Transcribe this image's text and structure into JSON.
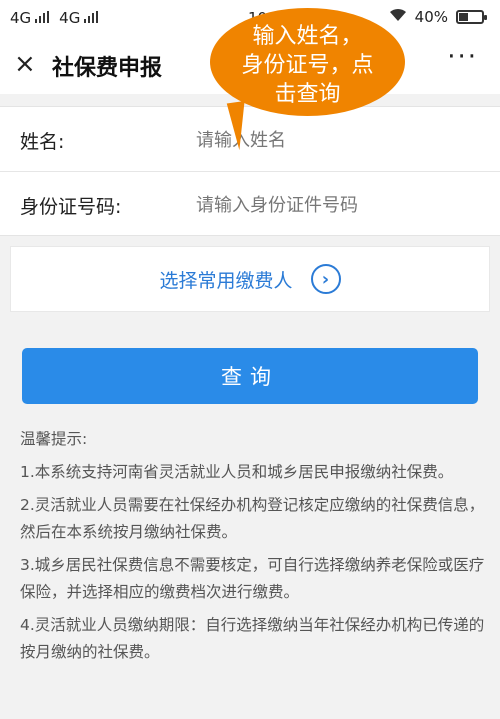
{
  "status_bar": {
    "carrier1": "4G",
    "carrier2": "4G",
    "time": "10",
    "battery": "40%",
    "battery_level": 0.4
  },
  "nav": {
    "close_symbol": "×",
    "title": "社保费申报",
    "more_symbol": "···"
  },
  "form": {
    "name_label": "姓名:",
    "name_placeholder": "请输入姓名",
    "id_label": "身份证号码:",
    "id_placeholder": "请输入身份证件号码"
  },
  "payer": {
    "label": "选择常用缴费人",
    "icon": "chevron-right-circle-icon"
  },
  "query_button": "查询",
  "tips": {
    "heading": "温馨提示:",
    "items": [
      "1.本系统支持河南省灵活就业人员和城乡居民申报缴纳社保费。",
      "2.灵活就业人员需要在社保经办机构登记核定应缴纳的社保费信息，然后在本系统按月缴纳社保费。",
      "3.城乡居民社保费信息不需要核定，可自行选择缴纳养老保险或医疗保险，并选择相应的缴费档次进行缴费。",
      "4.灵活就业人员缴纳期限：自行选择缴纳当年社保经办机构已传递的按月缴纳的社保费。"
    ]
  },
  "annotation": {
    "line1": "输入姓名，",
    "line2": "身份证号，点",
    "line3": "击查询",
    "color": "#f08400"
  },
  "colors": {
    "accent": "#2a8be8",
    "link": "#2b7bd6"
  }
}
